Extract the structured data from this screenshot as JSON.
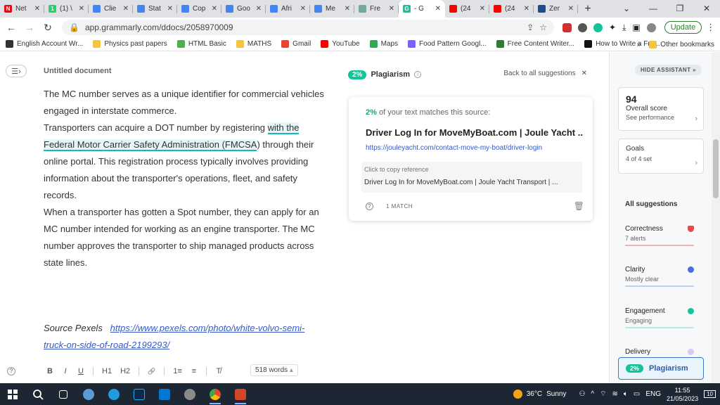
{
  "browser": {
    "tabs": [
      {
        "label": "Net",
        "fav_color": "#e50914",
        "fav_glyph": "N"
      },
      {
        "label": "(1) \\",
        "fav_color": "#25d366",
        "fav_glyph": "1"
      },
      {
        "label": "Clie",
        "fav_color": "#4285f4",
        "fav_glyph": ""
      },
      {
        "label": "Stat",
        "fav_color": "#4285f4",
        "fav_glyph": ""
      },
      {
        "label": "Cop",
        "fav_color": "#4285f4",
        "fav_glyph": ""
      },
      {
        "label": "Goo",
        "fav_color": "#4285f4",
        "fav_glyph": ""
      },
      {
        "label": "Afri",
        "fav_color": "#4285f4",
        "fav_glyph": ""
      },
      {
        "label": "Me",
        "fav_color": "#4285f4",
        "fav_glyph": ""
      },
      {
        "label": "Fre",
        "fav_color": "#74aa9c",
        "fav_glyph": ""
      },
      {
        "label": "- G",
        "fav_color": "#15c39a",
        "fav_glyph": "G",
        "active": true
      },
      {
        "label": "(24",
        "fav_color": "#ff0000",
        "fav_glyph": ""
      },
      {
        "label": "(24",
        "fav_color": "#ff0000",
        "fav_glyph": ""
      },
      {
        "label": "Zer",
        "fav_color": "#1a4d8f",
        "fav_glyph": ""
      }
    ],
    "new_tab": "+",
    "window_controls": [
      "⌄",
      "—",
      "❐",
      "✕"
    ],
    "url": "app.grammarly.com/ddocs/2058970009",
    "update_label": "Update",
    "bookmarks": [
      {
        "label": "English Account Wr...",
        "color": "#333333"
      },
      {
        "label": "Physics past papers",
        "color": "#f4c542"
      },
      {
        "label": "HTML Basic",
        "color": "#4caf50"
      },
      {
        "label": "MATHS",
        "color": "#f4c542"
      },
      {
        "label": "Gmail",
        "color": "#ea4335"
      },
      {
        "label": "YouTube",
        "color": "#ff0000"
      },
      {
        "label": "Maps",
        "color": "#34a853"
      },
      {
        "label": "Food Pattern Googl...",
        "color": "#7b61ff"
      },
      {
        "label": "Free Content Writer...",
        "color": "#2e7d32"
      },
      {
        "label": "How to Write a Fre...",
        "color": "#111111"
      }
    ],
    "bookmarks_more": "»",
    "other_bookmarks": "Other bookmarks"
  },
  "document": {
    "title": "Untitled document",
    "paragraphs": [
      {
        "before": "The MC number serves as a unique identifier for commercial vehicles engaged in interstate commerce.",
        "highlight": "",
        "after": ""
      },
      {
        "before": "Transporters can acquire a DOT number by registering ",
        "highlight": "with the Federal Motor Carrier Safety Administration (FMCSA",
        "after": ") through their online portal. This registration process typically involves providing information about the transporter's operations, fleet, and safety records."
      },
      {
        "before": "When a transporter has gotten a Spot number, they can apply for an MC number intended for working as an engine transporter. The MC number approves the transporter to ship managed products across state lines.",
        "highlight": "",
        "after": ""
      }
    ],
    "source_prefix": "Source Pexels",
    "source_link": "https://www.pexels.com/photo/white-volvo-semi-truck-on-side-of-road-2199293/",
    "toolbar": {
      "bold": "B",
      "italic": "I",
      "underline": "U",
      "h1": "H1",
      "h2": "H2",
      "link": "🔗",
      "ol": "1≡",
      "ul": "≡",
      "clear": "T̸"
    },
    "word_count": "518 words"
  },
  "plagiarism": {
    "percent": "2%",
    "title": "Plagiarism",
    "back_label": "Back to all suggestions",
    "match_percent": "2%",
    "match_text": "of your text matches this source:",
    "source_title": "Driver Log In for MoveMyBoat.com | Joule Yacht ...",
    "source_url": "https://jouleyacht.com/contact-move-my-boat/driver-login",
    "copy_label": "Click to copy reference",
    "reference": "Driver Log In for MoveMyBoat.com | Joule Yacht Transport | ...",
    "match_count": "1 MATCH"
  },
  "assistant": {
    "hide_label": "HIDE ASSISTANT",
    "score": "94",
    "score_label": "Overall score",
    "score_sub": "See performance",
    "goals_label": "Goals",
    "goals_sub": "4 of 4 set",
    "all_suggestions": "All suggestions",
    "categories": [
      {
        "label": "Correctness",
        "sub": "7 alerts",
        "color": "#e5484d"
      },
      {
        "label": "Clarity",
        "sub": "Mostly clear",
        "color": "#4a6ee0"
      },
      {
        "label": "Engagement",
        "sub": "Engaging",
        "color": "#15c39a"
      },
      {
        "label": "Delivery",
        "sub": "",
        "color": "#b38cf0"
      }
    ],
    "plag_button_pct": "2%",
    "plag_button_label": "Plagiarism"
  },
  "taskbar": {
    "temperature": "36°C",
    "weather": "Sunny",
    "language": "ENG",
    "time": "11:55",
    "date": "21/05/2023",
    "notifications": "10"
  }
}
